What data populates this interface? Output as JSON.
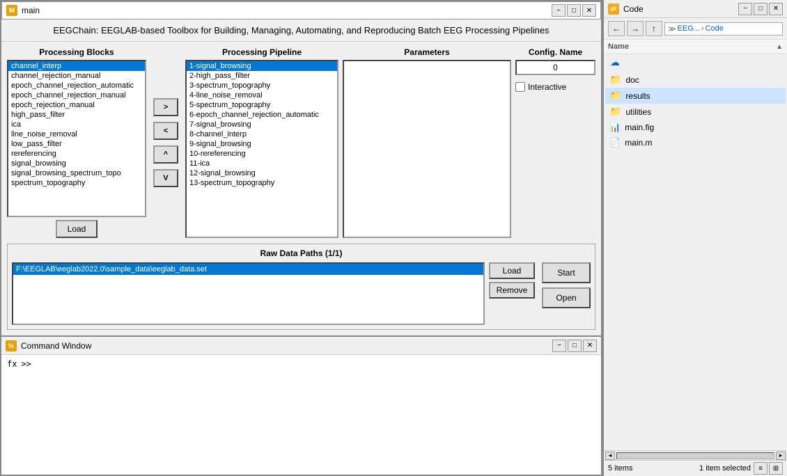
{
  "main_window": {
    "title": "main",
    "header": "EEGChain: EEGLAB-based Toolbox for Building, Managing, Automating, and Reproducing Batch EEG Processing Pipelines"
  },
  "processing_blocks": {
    "title": "Processing Blocks",
    "items": [
      "channel_interp",
      "channel_rejection_manual",
      "epoch_channel_rejection_automatic",
      "epoch_channel_rejection_manual",
      "epoch_rejection_manual",
      "high_pass_filter",
      "ica",
      "line_noise_removal",
      "low_pass_filter",
      "rereferencing",
      "signal_browsing",
      "signal_browsing_spectrum_topo",
      "spectrum_topography"
    ],
    "selected": "channel_interp"
  },
  "arrow_buttons": {
    "right": ">",
    "left": "<",
    "up": "^",
    "down": "V",
    "load": "Load"
  },
  "processing_pipeline": {
    "title": "Processing Pipeline",
    "items": [
      "1-signal_browsing",
      "2-high_pass_filter",
      "3-spectrum_topography",
      "4-line_noise_removal",
      "5-spectrum_topography",
      "6-epoch_channel_rejection_automatic",
      "7-signal_browsing",
      "8-channel_interp",
      "9-signal_browsing",
      "10-rereferencing",
      "11-ica",
      "12-signal_browsing",
      "13-spectrum_topography"
    ],
    "selected": "1-signal_browsing"
  },
  "parameters": {
    "title": "Parameters"
  },
  "config": {
    "title": "Config. Name",
    "value": "0",
    "interactive_label": "Interactive",
    "interactive_checked": false
  },
  "raw_data": {
    "title": "Raw Data Paths (1/1)",
    "items": [
      "F:\\EEGLAB\\eeglab2022.0\\sample_data\\eeglab_data.set"
    ],
    "load_btn": "Load",
    "remove_btn": "Remove",
    "start_btn": "Start",
    "open_btn": "Open"
  },
  "command_window": {
    "title": "Command Window",
    "prompt": "fx",
    "cursor": ">>"
  },
  "code_browser": {
    "title": "Code",
    "nav": {
      "back": "←",
      "forward": "→",
      "up": "↑",
      "path_parts": [
        "EEG...",
        "Code"
      ]
    },
    "tree": {
      "header": "Name",
      "items": [
        {
          "type": "folder",
          "name": "doc",
          "selected": false
        },
        {
          "type": "folder",
          "name": "results",
          "selected": true
        },
        {
          "type": "folder",
          "name": "utilities",
          "selected": false
        },
        {
          "type": "fig_file",
          "name": "main.fig",
          "selected": false
        },
        {
          "type": "m_file",
          "name": "main.m",
          "selected": false
        }
      ]
    },
    "status": {
      "count": "5 items",
      "selected": "1 item selected"
    }
  }
}
